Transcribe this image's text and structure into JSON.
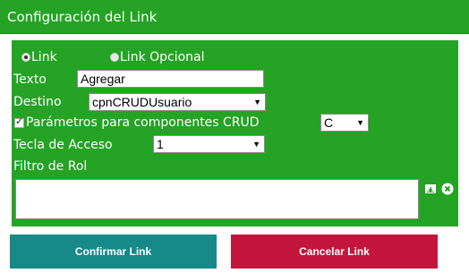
{
  "dialog": {
    "title": "Configuración del Link"
  },
  "form": {
    "radio_link_label": "Link",
    "radio_link_optional_label": "Link Opcional",
    "link_type_selected": "Link",
    "texto_label": "Texto",
    "texto_value": "Agregar",
    "destino_label": "Destino",
    "destino_value": "cpnCRUDUsuario",
    "crud_params_label": "Parámetros para componentes CRUD",
    "crud_params_checked": true,
    "crud_value": "C",
    "access_key_label": "Tecla de Acceso",
    "access_key_value": "1",
    "role_filter_label": "Filtro de Rol",
    "role_filter_value": ""
  },
  "actions": {
    "confirm_label": "Confirmar Link",
    "cancel_label": "Cancelar Link"
  },
  "icons": {
    "add_role": "inbox-download-icon",
    "clear_role": "close-circle-icon"
  },
  "colors": {
    "panel_green": "#24a324",
    "confirm_teal": "#168989",
    "cancel_red": "#c4163d"
  }
}
